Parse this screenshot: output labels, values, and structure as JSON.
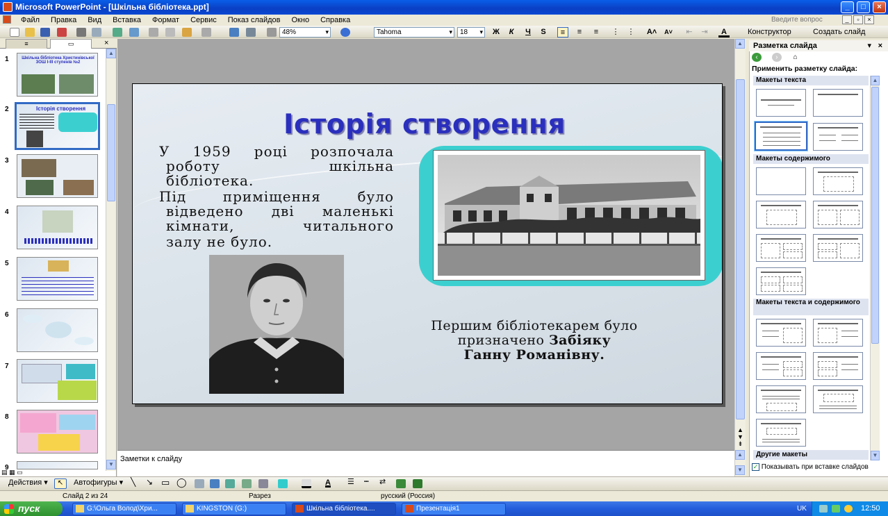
{
  "window": {
    "title": "Microsoft PowerPoint - [Шкільна бібліотека.ppt]"
  },
  "menu": [
    "Файл",
    "Правка",
    "Вид",
    "Вставка",
    "Формат",
    "Сервис",
    "Показ слайдов",
    "Окно",
    "Справка"
  ],
  "help_box": {
    "placeholder": "Введите вопрос"
  },
  "toolbar": {
    "zoom": "48%",
    "font": "Tahoma",
    "font_size": "18",
    "bold": "Ж",
    "italic": "К",
    "underline": "Ч",
    "shadow": "S",
    "designer": "Конструктор",
    "new_slide": "Создать слайд"
  },
  "slides_pane": {
    "numbers": [
      "1",
      "2",
      "3",
      "4",
      "5",
      "6",
      "7",
      "8",
      "9"
    ],
    "slide1_title": "Шкільна бібліотека Христинівської ЗОШ І-ІІІ ступенів №2",
    "slide2_title": "Історія створення"
  },
  "slide": {
    "title": "Історія створення",
    "p1": [
      "У 1959 році розпочала",
      "роботу шкільна",
      "бібліотека."
    ],
    "p2": [
      "Під приміщення було",
      "відведено дві маленькі",
      "кімнати, читального",
      "залу не було."
    ],
    "caption_line1": "Першим бібліотекарем було",
    "caption_line2a": "призначено ",
    "caption_line2b": "Забіяку",
    "caption_line3": "Ганну Романівну."
  },
  "notes": {
    "placeholder": "Заметки к слайду"
  },
  "task_pane": {
    "title": "Разметка слайда",
    "apply_label": "Применить разметку слайда:",
    "sec_text": "Макеты текста",
    "sec_content": "Макеты содержимого",
    "sec_text_content": "Макеты текста и содержимого",
    "sec_other": "Другие макеты",
    "show_on_insert": "Показывать при вставке слайдов"
  },
  "drawing": {
    "actions": "Действия",
    "autoshapes": "Автофигуры"
  },
  "status": {
    "slide": "Слайд 2 из 24",
    "design": "Разрез",
    "language": "русский (Россия)"
  },
  "taskbar": {
    "start": "пуск",
    "items": [
      "G:\\Ольга Волод\\Хри...",
      "KINGSTON (G:)",
      "Шкільна бібліотека....",
      "Презентація1"
    ],
    "lang": "UK",
    "clock": "12:50"
  }
}
